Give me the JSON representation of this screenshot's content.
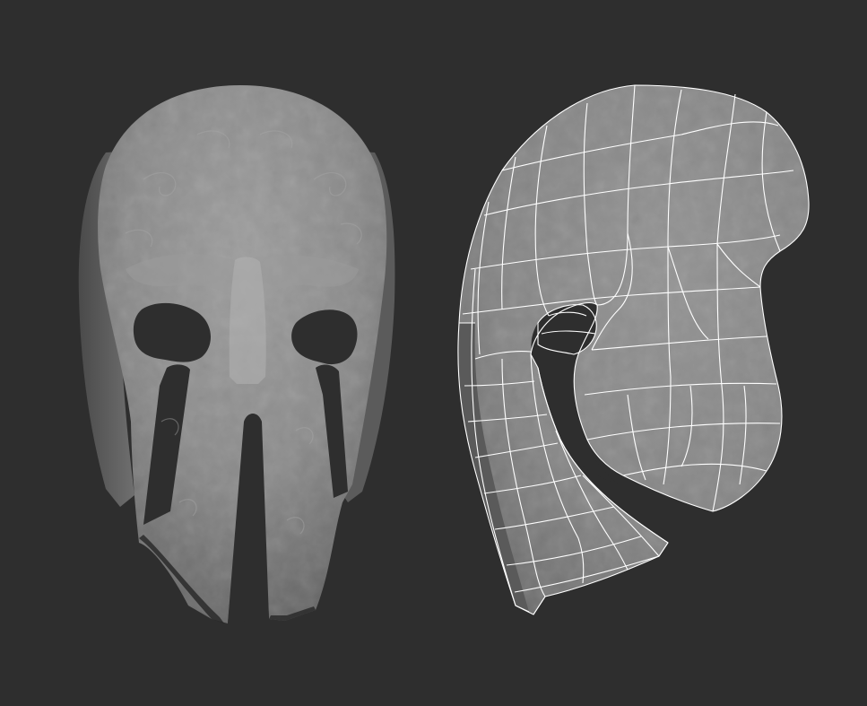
{
  "scene": {
    "background_color": "#2e2e2e",
    "surface_color": "#8c8c8c",
    "wire_color": "#ffffff",
    "objects": [
      {
        "name": "front-view",
        "render_mode": "shaded-sculpt"
      },
      {
        "name": "side-view",
        "render_mode": "shaded-wireframe"
      }
    ]
  }
}
